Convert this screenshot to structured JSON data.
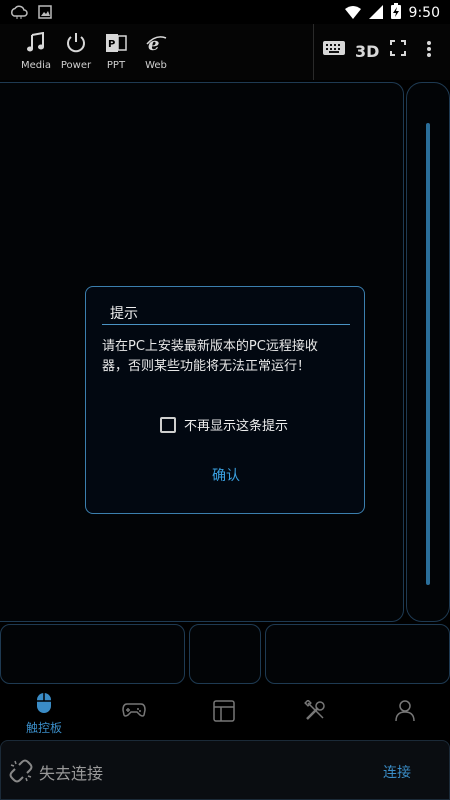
{
  "status_bar": {
    "time": "9:50"
  },
  "toolbar": {
    "items": [
      {
        "label": "Media",
        "icon": "music-note-icon"
      },
      {
        "label": "Power",
        "icon": "power-icon"
      },
      {
        "label": "PPT",
        "icon": "powerpoint-icon"
      },
      {
        "label": "Web",
        "icon": "internet-explorer-icon"
      }
    ],
    "right": {
      "three_d_label": "3D"
    }
  },
  "dialog": {
    "title": "提示",
    "message": "请在PC上安装最新版本的PC远程接收器，否则某些功能将无法正常运行！",
    "checkbox_label": "不再显示这条提示",
    "checkbox_checked": false,
    "confirm_label": "确认"
  },
  "bottom_nav": {
    "tabs": [
      {
        "label": "触控板",
        "icon": "mouse-icon",
        "active": true
      },
      {
        "label": "",
        "icon": "gamepad-icon",
        "active": false
      },
      {
        "label": "",
        "icon": "layout-icon",
        "active": false
      },
      {
        "label": "",
        "icon": "tools-icon",
        "active": false
      },
      {
        "label": "",
        "icon": "user-icon",
        "active": false
      }
    ]
  },
  "connection": {
    "status": "失去连接",
    "connect_label": "连接"
  },
  "colors": {
    "accent": "#3a8cc6",
    "panel_border": "#1e3a52",
    "dialog_border": "#3b7fae"
  }
}
